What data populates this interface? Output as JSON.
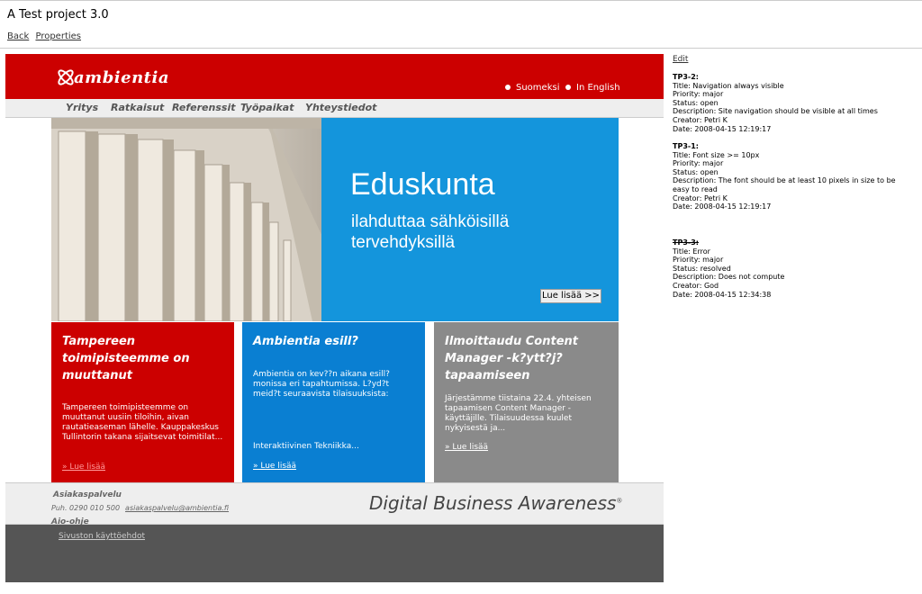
{
  "app": {
    "title": "A Test project 3.0",
    "back_link": "Back",
    "properties_link": "Properties"
  },
  "site": {
    "logo_text": "ambientia",
    "languages": [
      "Suomeksi",
      "In English"
    ],
    "nav": [
      "Yritys",
      "Ratkaisut",
      "Referenssit",
      "Työpaikat",
      "Yhteystiedot"
    ],
    "hero": {
      "title": "Eduskunta",
      "subtitle": "ilahduttaa sähköisillä tervehdyksillä",
      "button": "Lue lisää >>"
    },
    "boxes": [
      {
        "title": "Tampereen toimipisteemme on muuttanut",
        "text": "Tampereen toimipisteemme on muuttanut uusiin tiloihin, aivan rautatieaseman lähelle. Kauppakeskus Tullintorin takana sijaitsevat toimitilat...",
        "link": "» Lue lisää"
      },
      {
        "title": "Ambientia esill?",
        "text": "Ambientia on kev??n aikana esill? monissa eri tapahtumissa. L?yd?t meid?t seuraavista tilaisuuksista:",
        "extra": "Interaktiivinen Tekniikka...",
        "link": "» Lue lisää"
      },
      {
        "title": "Ilmoittaudu Content Manager -k?ytt?j?tapaamiseen",
        "text": "Järjestämme tiistaina 22.4. yhteisen tapaamisen Content Manager -käyttäjille. Tilaisuudessa kuulet nykyisestä ja...",
        "link": "» Lue lisää"
      }
    ],
    "footer": {
      "title": "Asiakaspalvelu",
      "phone": "Puh. 0290 010 500",
      "email": "asiakaspalvelu@ambientia.fi",
      "tagline": "Digital Business Awareness",
      "trademark": "®",
      "aio": "Aio-ohje",
      "terms": "Sivuston käyttöehdot"
    }
  },
  "sidebar": {
    "edit": "Edit",
    "issues": [
      {
        "id": "TP3-2:",
        "lines": [
          "Title: Navigation always visible",
          "Priority: major",
          "Status: open",
          "Description: Site navigation should be visible at all times",
          "Creator: Petri K",
          "Date: 2008-04-15 12:19:17"
        ]
      },
      {
        "id": "TP3-1:",
        "lines": [
          "Title: Font size >= 10px",
          "Priority: major",
          "Status: open",
          "Description: The font should be at least 10 pixels in size to be easy to read",
          "Creator: Petri K",
          "Date: 2008-04-15 12:19:17"
        ]
      },
      {
        "id": "TP3-3:",
        "lines": [
          "Title: Error",
          "Priority: major",
          "Status: resolved",
          "Description: Does not compute",
          "Creator: God",
          "Date: 2008-04-15 12:34:38"
        ]
      }
    ]
  }
}
